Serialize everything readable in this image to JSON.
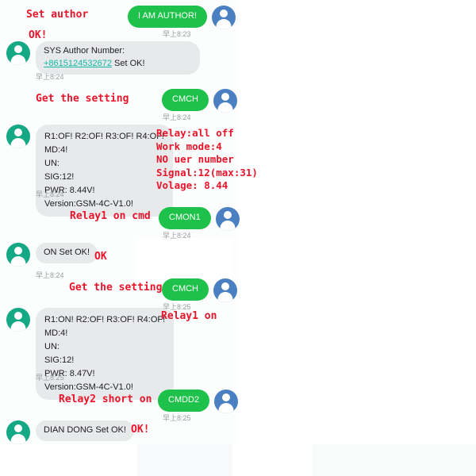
{
  "theme": {
    "outgoing_bubble_color": "#1ec24a",
    "incoming_bubble_color": "#e8e9eb",
    "annotation_color": "#e8142a",
    "link_color": "#12b8a6",
    "avatar_out_color": "#4a7fc1",
    "avatar_in_color": "#15a884",
    "timestamp_color": "#9a9da1",
    "background_color": "#ffffff"
  },
  "messages": [
    {
      "id": "m1",
      "direction": "outgoing",
      "text": "I AM AUTHOR!",
      "timestamp": "早上8:23",
      "avatar": "user-avatar-blue"
    },
    {
      "id": "m2",
      "direction": "incoming",
      "text_before_link": "SYS Author Number: ",
      "link": "+8615124532672",
      "text_after_link": " Set OK!",
      "timestamp": "早上8:24",
      "avatar": "device-avatar-teal"
    },
    {
      "id": "m3",
      "direction": "outgoing",
      "text": "CMCH",
      "timestamp": "早上8:24",
      "avatar": "user-avatar-blue"
    },
    {
      "id": "m4",
      "direction": "incoming",
      "text": "R1:OF! R2:OF! R3:OF! R4:OF!\nMD:4!\nUN:\nSIG:12!\nPWR: 8.44V!\nVersion:GSM-4C-V1.0!",
      "timestamp": "早上8:24",
      "avatar": "device-avatar-teal"
    },
    {
      "id": "m5",
      "direction": "outgoing",
      "text": "CMON1",
      "timestamp": "早上8:24",
      "avatar": "user-avatar-blue"
    },
    {
      "id": "m6",
      "direction": "incoming",
      "text": "ON Set OK!",
      "timestamp": "早上8:24",
      "avatar": "device-avatar-teal"
    },
    {
      "id": "m7",
      "direction": "outgoing",
      "text": "CMCH",
      "timestamp": "早上8:25",
      "avatar": "user-avatar-blue"
    },
    {
      "id": "m8",
      "direction": "incoming",
      "text": "R1:ON! R2:OF! R3:OF! R4:OF!\nMD:4!\nUN:\nSIG:12!\nPWR: 8.47V!\nVersion:GSM-4C-V1.0!",
      "timestamp": "早上8:25",
      "avatar": "device-avatar-teal"
    },
    {
      "id": "m9",
      "direction": "outgoing",
      "text": "CMDD2",
      "timestamp": "早上8:25",
      "avatar": "user-avatar-blue"
    },
    {
      "id": "m10",
      "direction": "incoming",
      "text": "DIAN DONG Set OK!",
      "timestamp": "",
      "avatar": "device-avatar-teal"
    }
  ],
  "annotations": [
    {
      "id": "a1",
      "text": "Set author"
    },
    {
      "id": "a2",
      "text": "OK!"
    },
    {
      "id": "a3",
      "text": "Get the setting"
    },
    {
      "id": "a4",
      "text": "Relay:all off\nWork mode:4\nNO uer number\nSignal:12(max:31)\nVolage: 8.44"
    },
    {
      "id": "a5",
      "text": "Relay1 on cmd"
    },
    {
      "id": "a6",
      "text": "OK"
    },
    {
      "id": "a7",
      "text": "Get the setting"
    },
    {
      "id": "a8",
      "text": "Relay1 on"
    },
    {
      "id": "a9",
      "text": "Relay2 short on"
    },
    {
      "id": "a10",
      "text": "OK!"
    }
  ]
}
